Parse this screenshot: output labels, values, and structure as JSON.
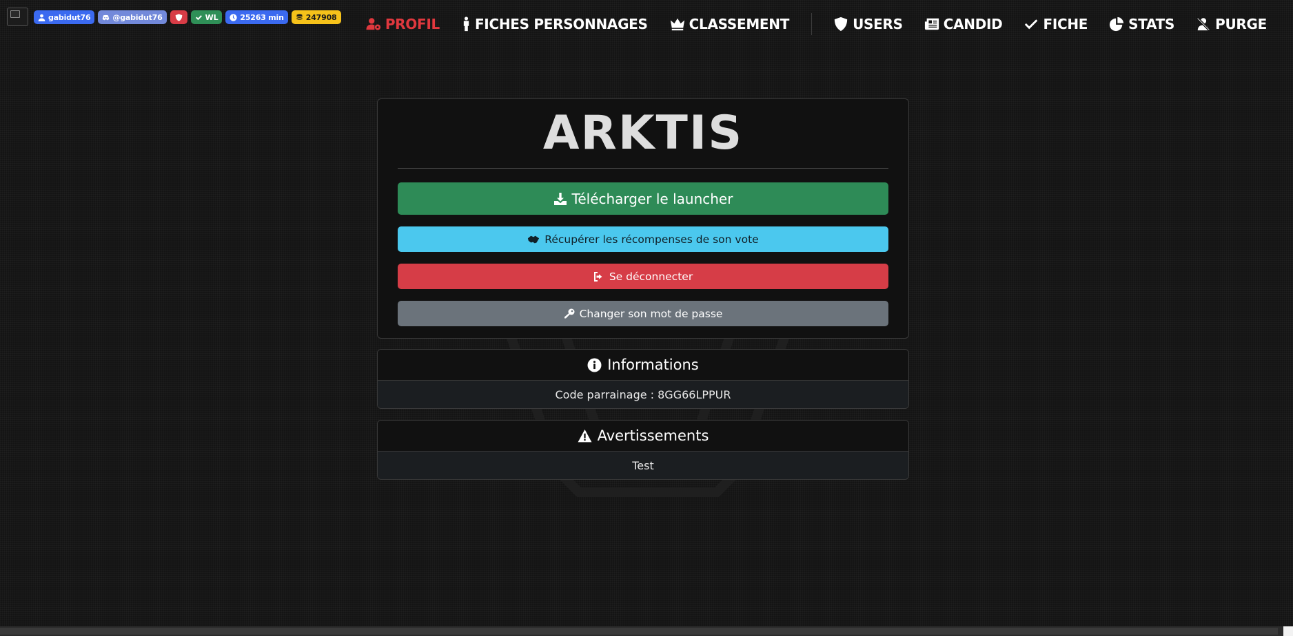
{
  "header": {
    "badges": [
      {
        "icon": "user-icon",
        "text": "gabidut76"
      },
      {
        "icon": "discord-icon",
        "text": "@gabidut76"
      },
      {
        "icon": "shield-icon",
        "text": ""
      },
      {
        "icon": "check-icon",
        "text": "WL"
      },
      {
        "icon": "clock-icon",
        "text": "25263 min"
      },
      {
        "icon": "coins-icon",
        "text": "247908"
      }
    ],
    "nav_left": [
      {
        "icon": "user-gear-icon",
        "label": "PROFIL",
        "active": true
      },
      {
        "icon": "person-icon",
        "label": "FICHES PERSONNAGES"
      },
      {
        "icon": "crown-icon",
        "label": "CLASSEMENT"
      }
    ],
    "nav_right": [
      {
        "icon": "shield-icon",
        "label": "USERS"
      },
      {
        "icon": "newspaper-icon",
        "label": "CANDID"
      },
      {
        "icon": "check-icon",
        "label": "FICHE"
      },
      {
        "icon": "pie-chart-icon",
        "label": "STATS"
      },
      {
        "icon": "user-slash-icon",
        "label": "PURGE"
      }
    ]
  },
  "main": {
    "brand": "ARKTIS",
    "buttons": {
      "download": "Télécharger le launcher",
      "vote": "Récupérer les récompenses de son vote",
      "logout": "Se déconnecter",
      "password": "Changer son mot de passe"
    }
  },
  "info": {
    "title": "Informations",
    "body": "Code parrainage : 8GG66LPPUR"
  },
  "warnings": {
    "title": "Avertissements",
    "body": "Test"
  },
  "colors": {
    "active_nav": "#e0383e",
    "download": "#2e8b57",
    "vote": "#4bc8ee",
    "logout": "#d63d47",
    "password": "#6b737b",
    "coins_badge": "#f6c21a"
  }
}
